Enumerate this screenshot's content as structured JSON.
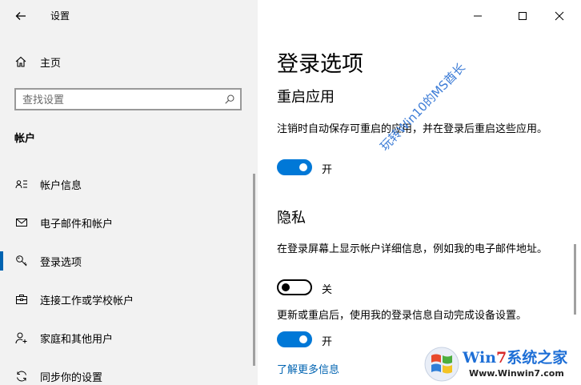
{
  "window": {
    "title": "设置",
    "back_icon": "arrow-left-icon"
  },
  "sidebar": {
    "home_label": "主页",
    "search_placeholder": "查找设置",
    "section_label": "帐户",
    "items": [
      {
        "label": "帐户信息",
        "icon": "person-card-icon"
      },
      {
        "label": "电子邮件和帐户",
        "icon": "mail-icon"
      },
      {
        "label": "登录选项",
        "icon": "key-icon",
        "active": true
      },
      {
        "label": "连接工作或学校帐户",
        "icon": "briefcase-icon"
      },
      {
        "label": "家庭和其他用户",
        "icon": "person-add-icon"
      },
      {
        "label": "同步你的设置",
        "icon": "sync-icon"
      }
    ]
  },
  "main": {
    "title": "登录选项",
    "restart_apps": {
      "heading": "重启应用",
      "description": "注销时自动保存可重启的应用，并在登录后重启这些应用。",
      "toggle_state": "开"
    },
    "privacy": {
      "heading": "隐私",
      "show_details": "在登录屏幕上显示帐户详细信息，例如我的电子邮件地址。",
      "show_details_state": "关",
      "auto_finish": "更新或重启后，使用我的登录信息自动完成设备设置。",
      "auto_finish_state": "开"
    },
    "learn_more": "了解更多信息"
  },
  "watermark": "玩转Win10的MS酋长",
  "logo": {
    "brand_a": "Win",
    "brand_b": "7",
    "brand_c": "系统之家",
    "url": "Www.Winwin7.com"
  },
  "colors": {
    "accent": "#0078d7",
    "sidebar_bg": "#f2f2f2",
    "link": "#0063b1"
  }
}
